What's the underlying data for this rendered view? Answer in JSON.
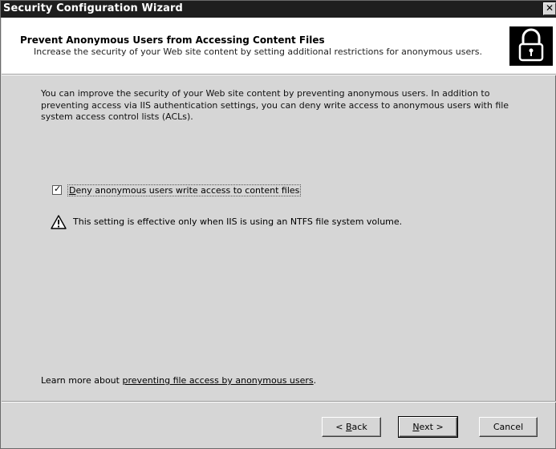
{
  "window": {
    "title": "Security Configuration Wizard",
    "close_glyph": "✕"
  },
  "header": {
    "heading": "Prevent Anonymous Users from Accessing Content Files",
    "subheading": "Increase the security of your Web site content by setting additional restrictions for anonymous users.",
    "icon": "lock-icon"
  },
  "body": {
    "paragraph": "You can improve the security of your Web site content by preventing anonymous users.  In addition to preventing access via IIS authentication settings, you can deny write access to anonymous users with file system access control lists (ACLs).",
    "checkbox": {
      "label_access_key": "D",
      "label_rest": "eny anonymous users write access to content files",
      "checked": true,
      "mark": "✓"
    },
    "warning": {
      "icon": "warning-icon",
      "text": "This setting is effective only when IIS is using an NTFS file system volume."
    },
    "learn_more": {
      "prefix": "Learn more about ",
      "link": "preventing file access by anonymous users",
      "suffix": "."
    }
  },
  "buttons": {
    "back": {
      "prefix": "< ",
      "access_key": "B",
      "rest": "ack"
    },
    "next": {
      "access_key": "N",
      "rest": "ext >"
    },
    "cancel": {
      "label": "Cancel"
    }
  },
  "colors": {
    "titlebar": "#1e1e1e",
    "dialog": "#d6d6d6",
    "header": "#ffffff"
  }
}
